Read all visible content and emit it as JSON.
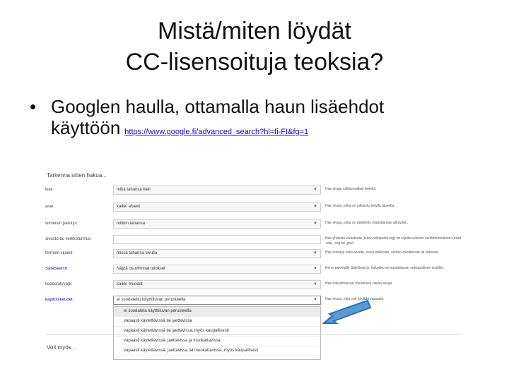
{
  "slide": {
    "title_line1": "Mistä/miten löydät",
    "title_line2": "CC-lisensoituja teoksia?",
    "bullet_symbol": "•",
    "bullet_text": "Googlen haulla, ottamalla haun lisäehdot käyttöön",
    "bullet_link": "https://www.google.fi/advanced_search?hl=fi-FI&fg=1"
  },
  "screenshot": {
    "heading": "Tarkenna sitten hakua...",
    "rows": [
      {
        "label": "kieli:",
        "value": "mikä tahansa kieli",
        "help": "Hae sivuja valitsemallasi kielellä."
      },
      {
        "label": "alue:",
        "value": "kaikki alueet",
        "help": "Hae sivuja, jotka on julkaistu tietyllä alueella."
      },
      {
        "label": "viimeisin päivitys:",
        "value": "milloin tahansa",
        "help": "Hae sivuja, jotka on päivitetty määrittämäsi aikavälin."
      },
      {
        "label": "sivusto tai verkkotunnus:",
        "value": "",
        "help": "Hae yhdestä sivustosta (kuten wikipedia.org) tai rajoita tulokset verkkotunnuksen (esim. .edu, .org tai .gov)."
      },
      {
        "label": "termien sijainti:",
        "value": "missä tahansa sivulla",
        "help": "Hae termejä koko sivulta, sivun otsikosta, verkko-osoitteesta tai linkeistä."
      },
      {
        "label": "SafeSearch:",
        "value": "Näytä osuvimmat tulokset",
        "help": "Kerro palvelulle SafeSearch, haluatko se suodattavan seksuaalisen sisällön."
      },
      {
        "label": "tiedostotyyppi:",
        "value": "kaikki muodot",
        "help": "Hae haluamassasi muodossa olevia sivuja."
      },
      {
        "label": "käyttöoikeudet:",
        "value": "ei suodatettu käyttöluvan perusteella",
        "help": "Hae sivuja, joita voit käyttää vapaasti."
      }
    ],
    "dropdown_options": [
      "ei suodateta käyttöluvan perusteella",
      "vapaasti käytettävissä tai jaettavissa",
      "vapaasti käytettävissä tai jaettavissa, myös kaupallisesti",
      "vapaasti käytettävissä, jaettavissa ja muokattavissa",
      "vapaasti käytettävissä, jaettavissa tai muokattavissa, myös kaupallisesti"
    ],
    "selected_option_index": 0,
    "footer_heading": "Voit myös...",
    "icons": {
      "dropdown": "chevron-down-icon",
      "pointer": "arrow-icon"
    },
    "colors": {
      "link": "#1a0dab",
      "arrow_fill": "#5b9bd5",
      "arrow_stroke": "#2e6fb0"
    }
  }
}
